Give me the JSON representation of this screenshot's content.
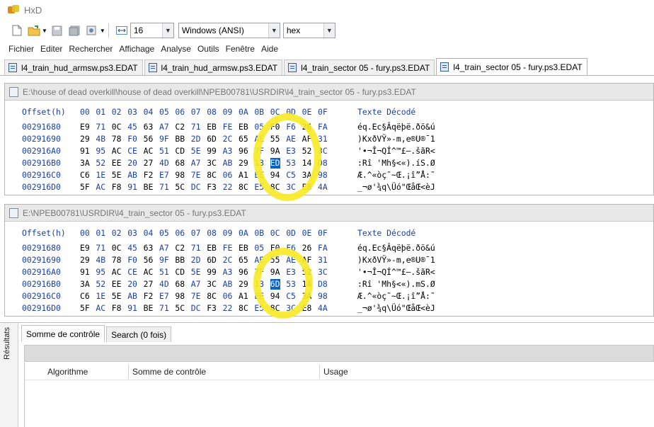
{
  "app": {
    "title": "HxD"
  },
  "toolbar": {
    "bytes_per_row": "16",
    "charset": "Windows (ANSI)",
    "offset_base": "hex"
  },
  "menu": [
    "Fichier",
    "Editer",
    "Rechercher",
    "Affichage",
    "Analyse",
    "Outils",
    "Fenêtre",
    "Aide"
  ],
  "tabs": [
    {
      "label": "l4_train_hud_armsw.ps3.EDAT"
    },
    {
      "label": "l4_train_hud_armsw.ps3.EDAT"
    },
    {
      "label": "l4_train_sector 05 - fury.ps3.EDAT"
    },
    {
      "label": "l4_train_sector 05 - fury.ps3.EDAT"
    }
  ],
  "header": {
    "offset": "Offset(h)",
    "cols": [
      "00",
      "01",
      "02",
      "03",
      "04",
      "05",
      "06",
      "07",
      "08",
      "09",
      "0A",
      "0B",
      "0C",
      "0D",
      "0E",
      "0F"
    ],
    "text": "Texte Décodé"
  },
  "panes": [
    {
      "path": "E:\\house of dead overkill\\house of dead overkill\\NPEB00781\\USRDIR\\l4_train_sector 05 - fury.ps3.EDAT",
      "rows": [
        {
          "offset": "00291680",
          "bytes": [
            "E9",
            "71",
            "0C",
            "45",
            "63",
            "A7",
            "C2",
            "71",
            "EB",
            "FE",
            "EB",
            "05",
            "F0",
            "F6",
            "26",
            "FA"
          ],
          "text": "éq.Ec§Âqëþë.ðö&ú"
        },
        {
          "offset": "00291690",
          "bytes": [
            "29",
            "4B",
            "78",
            "F0",
            "56",
            "9F",
            "BB",
            "2D",
            "6D",
            "2C",
            "65",
            "AE",
            "55",
            "AE",
            "AF",
            "31"
          ],
          "text": ")KxðVŸ»-m,e®U®¯1"
        },
        {
          "offset": "002916A0",
          "bytes": [
            "91",
            "95",
            "AC",
            "CE",
            "AC",
            "51",
            "CD",
            "5E",
            "99",
            "A3",
            "96",
            "7F",
            "9A",
            "E3",
            "52",
            "3C"
          ],
          "text": "'•¬Î¬QÍ^™£–.šãR<"
        },
        {
          "offset": "002916B0",
          "bytes": [
            "3A",
            "52",
            "EE",
            "20",
            "27",
            "4D",
            "68",
            "A7",
            "3C",
            "AB",
            "29",
            "13",
            "ED",
            "53",
            "14",
            "D8"
          ],
          "text": ":Rî 'Mh§<«).íS.Ø"
        },
        {
          "offset": "002916C0",
          "bytes": [
            "C6",
            "1E",
            "5E",
            "AB",
            "F2",
            "E7",
            "98",
            "7E",
            "8C",
            "06",
            "A1",
            "EE",
            "94",
            "C5",
            "3A",
            "98"
          ],
          "text": "Æ.^«òç˜~Œ.¡î”Å:˜"
        },
        {
          "offset": "002916D0",
          "bytes": [
            "5F",
            "AC",
            "F8",
            "91",
            "BE",
            "71",
            "5C",
            "DC",
            "F3",
            "22",
            "8C",
            "E5",
            "8C",
            "3C",
            "E8",
            "4A"
          ],
          "text": "_¬ø'¾q\\Üó\"ŒåŒ<èJ"
        }
      ]
    },
    {
      "path": "E:\\NPEB00781\\USRDIR\\l4_train_sector 05 - fury.ps3.EDAT",
      "rows": [
        {
          "offset": "00291680",
          "bytes": [
            "E9",
            "71",
            "0C",
            "45",
            "63",
            "A7",
            "C2",
            "71",
            "EB",
            "FE",
            "EB",
            "05",
            "F0",
            "F6",
            "26",
            "FA"
          ],
          "text": "éq.Ec§Âqëþë.ðö&ú"
        },
        {
          "offset": "00291690",
          "bytes": [
            "29",
            "4B",
            "78",
            "F0",
            "56",
            "9F",
            "BB",
            "2D",
            "6D",
            "2C",
            "65",
            "AE",
            "55",
            "AE",
            "AF",
            "31"
          ],
          "text": ")KxðVŸ»-m,e®U®¯1"
        },
        {
          "offset": "002916A0",
          "bytes": [
            "91",
            "95",
            "AC",
            "CE",
            "AC",
            "51",
            "CD",
            "5E",
            "99",
            "A3",
            "96",
            "7F",
            "9A",
            "E3",
            "52",
            "3C"
          ],
          "text": "'•¬Î¬QÍ^™£–.šãR<"
        },
        {
          "offset": "002916B0",
          "bytes": [
            "3A",
            "52",
            "EE",
            "20",
            "27",
            "4D",
            "68",
            "A7",
            "3C",
            "AB",
            "29",
            "13",
            "6D",
            "53",
            "14",
            "D8"
          ],
          "text": ":Rî 'Mh§<«).mS.Ø"
        },
        {
          "offset": "002916C0",
          "bytes": [
            "C6",
            "1E",
            "5E",
            "AB",
            "F2",
            "E7",
            "98",
            "7E",
            "8C",
            "06",
            "A1",
            "EE",
            "94",
            "C5",
            "3A",
            "98"
          ],
          "text": "Æ.^«òç˜~Œ.¡î”Å:˜"
        },
        {
          "offset": "002916D0",
          "bytes": [
            "5F",
            "AC",
            "F8",
            "91",
            "BE",
            "71",
            "5C",
            "DC",
            "F3",
            "22",
            "8C",
            "E5",
            "8C",
            "3C",
            "E8",
            "4A"
          ],
          "text": "_¬ø'¾q\\Üó\"ŒåŒ<èJ"
        }
      ]
    }
  ],
  "selected_byte_index": 12,
  "results_panel": {
    "side_tab": "Résultats",
    "tabs": [
      "Somme de contrôle",
      "Search (0 fois)"
    ],
    "columns": [
      "Algorithme",
      "Somme de contrôle",
      "Usage"
    ]
  },
  "colors": {
    "header_blue": "#1a3fa8",
    "selection": "#0a63c4",
    "highlight_ring": "#f7e928"
  }
}
